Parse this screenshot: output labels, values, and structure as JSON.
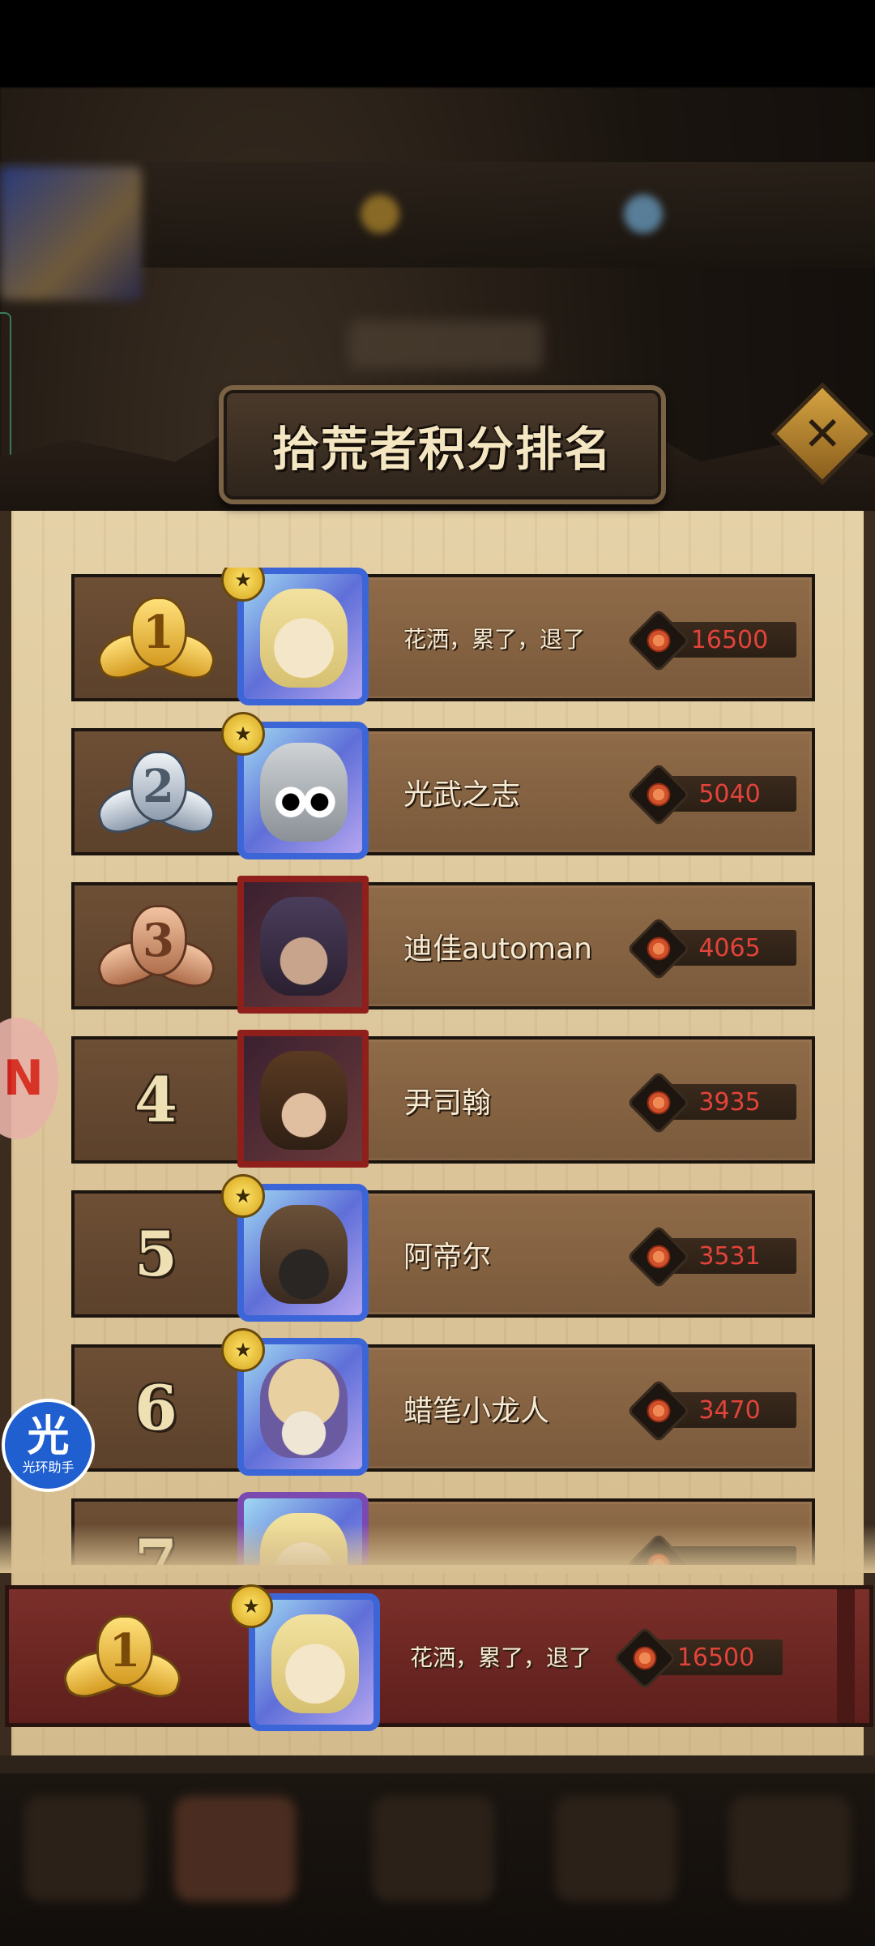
{
  "modal": {
    "title": "拾荒者积分排名",
    "close_icon": "close-icon"
  },
  "rankings": [
    {
      "rank": "1",
      "medal": "gold",
      "name": "花洒，累了，退了",
      "score": "16500",
      "avatar_frame": "blue",
      "avatar_icon": "blonde-helmet-hero",
      "star": true
    },
    {
      "rank": "2",
      "medal": "silver",
      "name": "光武之志",
      "score": "5040",
      "avatar_frame": "blue",
      "avatar_icon": "robot-hero",
      "star": true
    },
    {
      "rank": "3",
      "medal": "bronze",
      "name": "迪佳automan",
      "score": "4065",
      "avatar_frame": "red",
      "avatar_icon": "hooded-hero",
      "star": false
    },
    {
      "rank": "4",
      "medal": null,
      "name": "尹司翰",
      "score": "3935",
      "avatar_frame": "red",
      "avatar_icon": "cowboy-hero",
      "star": false
    },
    {
      "rank": "5",
      "medal": null,
      "name": "阿帝尔",
      "score": "3531",
      "avatar_frame": "blue",
      "avatar_icon": "masked-hero",
      "star": true
    },
    {
      "rank": "6",
      "medal": null,
      "name": "蜡笔小龙人",
      "score": "3470",
      "avatar_frame": "blue",
      "avatar_icon": "mushroom-hero",
      "star": true
    },
    {
      "rank": "7",
      "medal": null,
      "name": "",
      "score": "",
      "avatar_frame": "purple",
      "avatar_icon": "blonde-helmet-hero",
      "star": false
    }
  ],
  "my_rank": {
    "rank": "1",
    "medal": "gold",
    "name": "花洒，累了，退了",
    "score": "16500"
  },
  "overlays": {
    "assistant_glyph": "光",
    "assistant_label": "光环助手"
  },
  "colors": {
    "score_text": "#e2433a",
    "panel_bg": "#ddc79c",
    "row_bg": "#7a5a3c",
    "my_rank_bg": "#6e2824"
  }
}
